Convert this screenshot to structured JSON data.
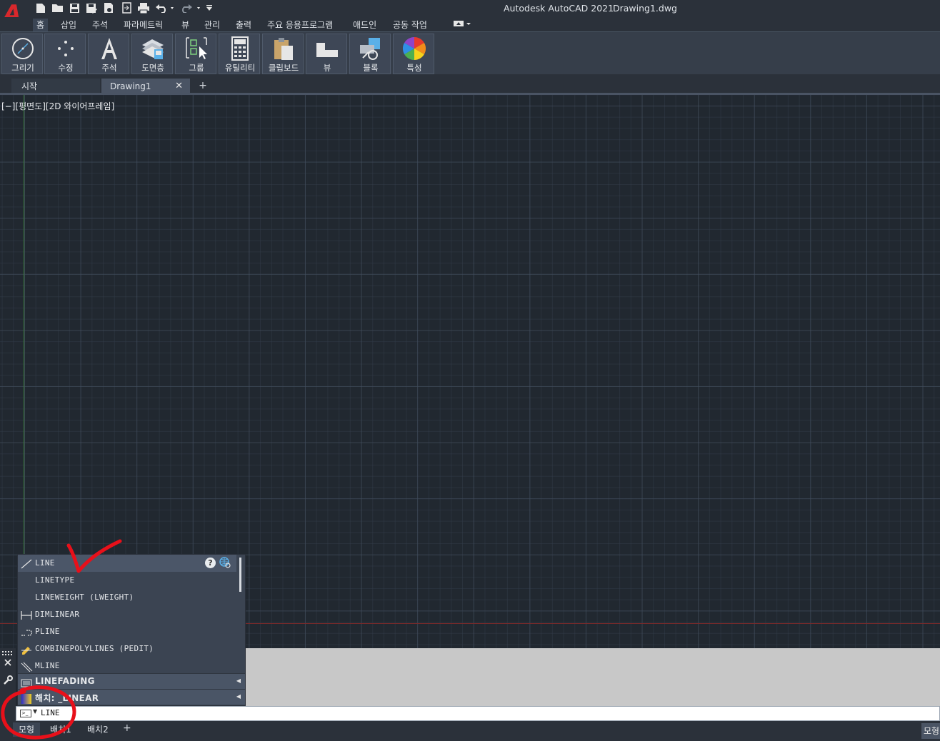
{
  "app": {
    "product": "Autodesk AutoCAD 2021",
    "file": "Drawing1.dwg",
    "logo_letter": "A"
  },
  "quick_access": [
    "new-icon",
    "open-icon",
    "save-icon",
    "save-as-icon",
    "print-preview-icon",
    "import-icon",
    "plot-icon",
    "undo-icon",
    "redo-icon",
    "customize-icon"
  ],
  "ribbon_tabs": [
    "홈",
    "삽입",
    "주석",
    "파라메트릭",
    "뷰",
    "관리",
    "출력",
    "주요 응용프로그램",
    "애드인",
    "공동 작업"
  ],
  "ribbon_buttons": [
    "그리기",
    "수정",
    "주석",
    "도면층",
    "그룹",
    "유틸리티",
    "클립보드",
    "뷰",
    "블록",
    "특성"
  ],
  "file_tabs": {
    "start": "시작",
    "drawing": "Drawing1",
    "close_glyph": "✕",
    "add_glyph": "+"
  },
  "viewport": {
    "label": "[−][평면도][2D 와이어프레임]"
  },
  "autocomplete": {
    "items": [
      {
        "text": "LINE",
        "icon": "line-icon"
      },
      {
        "text": "LINETYPE",
        "icon": ""
      },
      {
        "text": "LINEWEIGHT (LWEIGHT)",
        "icon": ""
      },
      {
        "text": "DIMLINEAR",
        "icon": "dimlinear-icon"
      },
      {
        "text": "PLINE",
        "icon": "pline-icon"
      },
      {
        "text": "COMBINEPOLYLINES (PEDIT)",
        "icon": "pedit-icon"
      },
      {
        "text": "MLINE",
        "icon": "mline-icon"
      }
    ],
    "sections": [
      {
        "text": "LINEFADING",
        "icon": "linefading-icon"
      },
      {
        "text": "해치: _LINEAR",
        "icon": "hatch-icon"
      }
    ],
    "help_glyph": "?"
  },
  "command_line": {
    "value": "LINE"
  },
  "layout_tabs": [
    "모형",
    "배치1",
    "배치2"
  ],
  "layout_add_glyph": "+",
  "status_bar": {
    "model": "모형"
  },
  "colors": {
    "canvas": "#212830",
    "ribbon": "#363e4a",
    "annotation": "#e8101a",
    "logo": "#d8282c"
  }
}
